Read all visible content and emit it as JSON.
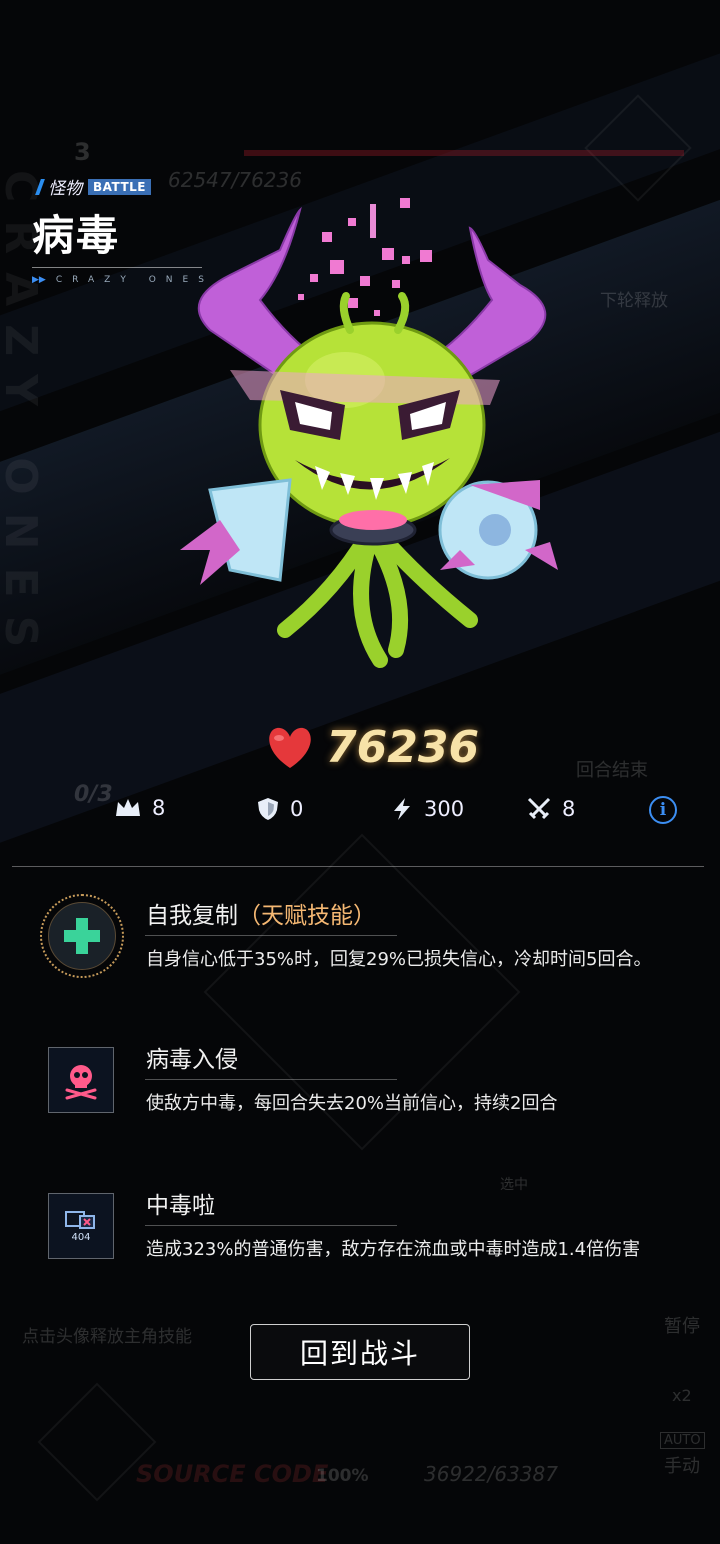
{
  "header": {
    "category": "怪物",
    "badge": "BATTLE",
    "title": "病毒",
    "subtitle": "CRAZY ONES"
  },
  "hp": {
    "value": "76236",
    "icon": "heart-icon"
  },
  "stats": [
    {
      "icon": "crown-icon",
      "value": "8"
    },
    {
      "icon": "shield-icon",
      "value": "0"
    },
    {
      "icon": "lightning-icon",
      "value": "300"
    },
    {
      "icon": "crossed-swords-icon",
      "value": "8"
    }
  ],
  "info_icon": "info-icon",
  "skills": [
    {
      "icon": "plus-cross-icon",
      "name": "自我复制",
      "tag": "（天赋技能）",
      "desc": "自身信心低于35%时，回复29%已损失信心，冷却时间5回合。"
    },
    {
      "icon": "skull-icon",
      "name": "病毒入侵",
      "desc": "使敌方中毒，每回合失去20%当前信心，持续2回合"
    },
    {
      "icon": "error-404-icon",
      "icon_text": "404",
      "name": "中毒啦",
      "desc": "造成323%的普通伤害，敌方存在流血或中毒时造成1.4倍伤害"
    }
  ],
  "back_button": "回到战斗",
  "background": {
    "round": "3",
    "enemy_hp": "62547/76236",
    "next_release": "下轮释放",
    "end_round": "回合结束",
    "energy": "0/3",
    "hint": "点击头像释放主角技能",
    "pause": "暂停",
    "speed": "x2",
    "auto": "AUTO",
    "manual": "手动",
    "source_code": "SOURCE CODE",
    "percent": "100%",
    "player_hp": "36922/63387",
    "selected": "选中"
  },
  "colors": {
    "accent_blue": "#3c8ef2",
    "hp_gold": "#f7e2a8",
    "talent_orange": "#f5b873",
    "heart_red": "#e5383b",
    "talent_green": "#3ad39a"
  }
}
